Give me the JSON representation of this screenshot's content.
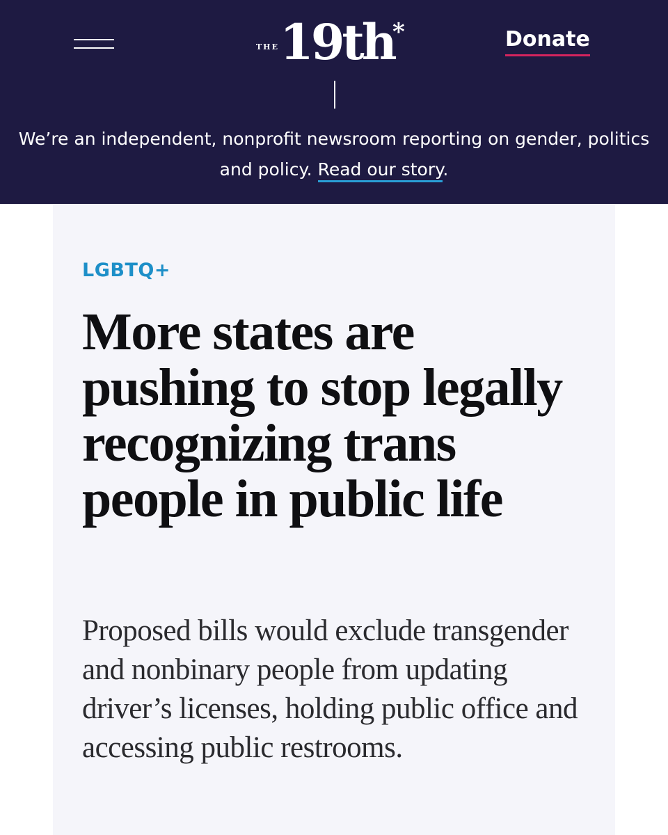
{
  "header": {
    "logo_prefix": "THE",
    "logo_mark": "19th",
    "logo_asterisk": "*",
    "donate_label": "Donate",
    "tagline_text": "We’re an independent, nonprofit newsroom reporting on gender, politics and policy.",
    "tagline_link": "Read our story",
    "tagline_period": "."
  },
  "article": {
    "category": "LGBTQ+",
    "headline": "More states are pushing to stop legally recognizing trans people in public life",
    "dek": "Proposed bills would exclude transgender and nonbinary people from updating driver’s licenses, holding public office and accessing public restrooms."
  },
  "colors": {
    "header_bg": "#1e1a42",
    "donate_underline": "#d4245e",
    "link_underline": "#2a9fd6",
    "category": "#1d8fc8",
    "content_bg": "#f5f5fa"
  },
  "icons": {
    "menu": "hamburger-menu-icon"
  }
}
